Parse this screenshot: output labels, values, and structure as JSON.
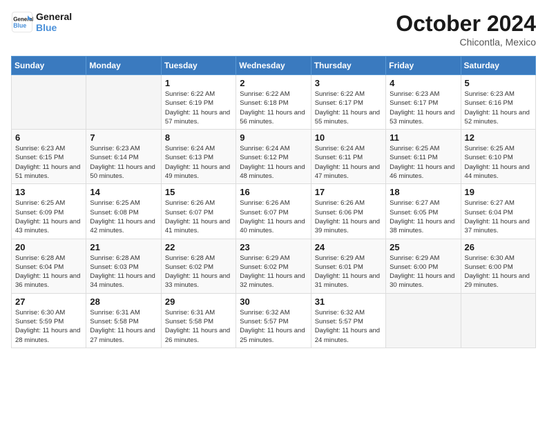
{
  "header": {
    "logo_line1": "General",
    "logo_line2": "Blue",
    "month": "October 2024",
    "location": "Chicontla, Mexico"
  },
  "weekdays": [
    "Sunday",
    "Monday",
    "Tuesday",
    "Wednesday",
    "Thursday",
    "Friday",
    "Saturday"
  ],
  "weeks": [
    [
      {
        "day": "",
        "info": ""
      },
      {
        "day": "",
        "info": ""
      },
      {
        "day": "1",
        "info": "Sunrise: 6:22 AM\nSunset: 6:19 PM\nDaylight: 11 hours and 57 minutes."
      },
      {
        "day": "2",
        "info": "Sunrise: 6:22 AM\nSunset: 6:18 PM\nDaylight: 11 hours and 56 minutes."
      },
      {
        "day": "3",
        "info": "Sunrise: 6:22 AM\nSunset: 6:17 PM\nDaylight: 11 hours and 55 minutes."
      },
      {
        "day": "4",
        "info": "Sunrise: 6:23 AM\nSunset: 6:17 PM\nDaylight: 11 hours and 53 minutes."
      },
      {
        "day": "5",
        "info": "Sunrise: 6:23 AM\nSunset: 6:16 PM\nDaylight: 11 hours and 52 minutes."
      }
    ],
    [
      {
        "day": "6",
        "info": "Sunrise: 6:23 AM\nSunset: 6:15 PM\nDaylight: 11 hours and 51 minutes."
      },
      {
        "day": "7",
        "info": "Sunrise: 6:23 AM\nSunset: 6:14 PM\nDaylight: 11 hours and 50 minutes."
      },
      {
        "day": "8",
        "info": "Sunrise: 6:24 AM\nSunset: 6:13 PM\nDaylight: 11 hours and 49 minutes."
      },
      {
        "day": "9",
        "info": "Sunrise: 6:24 AM\nSunset: 6:12 PM\nDaylight: 11 hours and 48 minutes."
      },
      {
        "day": "10",
        "info": "Sunrise: 6:24 AM\nSunset: 6:11 PM\nDaylight: 11 hours and 47 minutes."
      },
      {
        "day": "11",
        "info": "Sunrise: 6:25 AM\nSunset: 6:11 PM\nDaylight: 11 hours and 46 minutes."
      },
      {
        "day": "12",
        "info": "Sunrise: 6:25 AM\nSunset: 6:10 PM\nDaylight: 11 hours and 44 minutes."
      }
    ],
    [
      {
        "day": "13",
        "info": "Sunrise: 6:25 AM\nSunset: 6:09 PM\nDaylight: 11 hours and 43 minutes."
      },
      {
        "day": "14",
        "info": "Sunrise: 6:25 AM\nSunset: 6:08 PM\nDaylight: 11 hours and 42 minutes."
      },
      {
        "day": "15",
        "info": "Sunrise: 6:26 AM\nSunset: 6:07 PM\nDaylight: 11 hours and 41 minutes."
      },
      {
        "day": "16",
        "info": "Sunrise: 6:26 AM\nSunset: 6:07 PM\nDaylight: 11 hours and 40 minutes."
      },
      {
        "day": "17",
        "info": "Sunrise: 6:26 AM\nSunset: 6:06 PM\nDaylight: 11 hours and 39 minutes."
      },
      {
        "day": "18",
        "info": "Sunrise: 6:27 AM\nSunset: 6:05 PM\nDaylight: 11 hours and 38 minutes."
      },
      {
        "day": "19",
        "info": "Sunrise: 6:27 AM\nSunset: 6:04 PM\nDaylight: 11 hours and 37 minutes."
      }
    ],
    [
      {
        "day": "20",
        "info": "Sunrise: 6:28 AM\nSunset: 6:04 PM\nDaylight: 11 hours and 36 minutes."
      },
      {
        "day": "21",
        "info": "Sunrise: 6:28 AM\nSunset: 6:03 PM\nDaylight: 11 hours and 34 minutes."
      },
      {
        "day": "22",
        "info": "Sunrise: 6:28 AM\nSunset: 6:02 PM\nDaylight: 11 hours and 33 minutes."
      },
      {
        "day": "23",
        "info": "Sunrise: 6:29 AM\nSunset: 6:02 PM\nDaylight: 11 hours and 32 minutes."
      },
      {
        "day": "24",
        "info": "Sunrise: 6:29 AM\nSunset: 6:01 PM\nDaylight: 11 hours and 31 minutes."
      },
      {
        "day": "25",
        "info": "Sunrise: 6:29 AM\nSunset: 6:00 PM\nDaylight: 11 hours and 30 minutes."
      },
      {
        "day": "26",
        "info": "Sunrise: 6:30 AM\nSunset: 6:00 PM\nDaylight: 11 hours and 29 minutes."
      }
    ],
    [
      {
        "day": "27",
        "info": "Sunrise: 6:30 AM\nSunset: 5:59 PM\nDaylight: 11 hours and 28 minutes."
      },
      {
        "day": "28",
        "info": "Sunrise: 6:31 AM\nSunset: 5:58 PM\nDaylight: 11 hours and 27 minutes."
      },
      {
        "day": "29",
        "info": "Sunrise: 6:31 AM\nSunset: 5:58 PM\nDaylight: 11 hours and 26 minutes."
      },
      {
        "day": "30",
        "info": "Sunrise: 6:32 AM\nSunset: 5:57 PM\nDaylight: 11 hours and 25 minutes."
      },
      {
        "day": "31",
        "info": "Sunrise: 6:32 AM\nSunset: 5:57 PM\nDaylight: 11 hours and 24 minutes."
      },
      {
        "day": "",
        "info": ""
      },
      {
        "day": "",
        "info": ""
      }
    ]
  ]
}
